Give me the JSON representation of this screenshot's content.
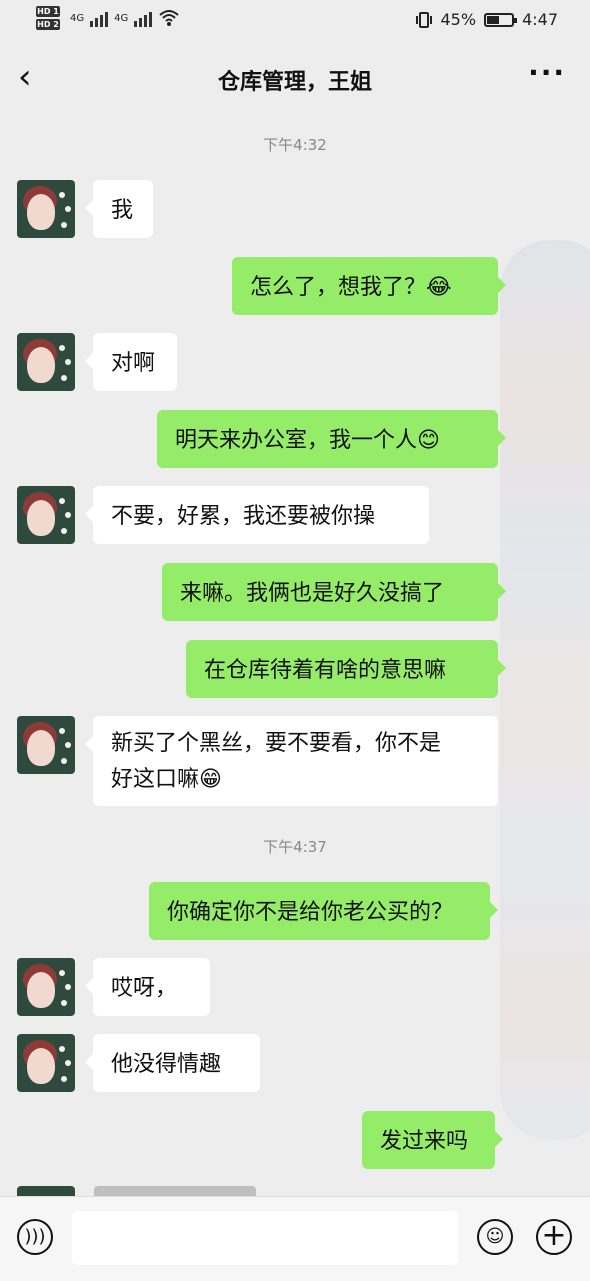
{
  "status": {
    "network_top": "HD 1",
    "network_bottom": "HD 2",
    "net_4g_1": "4G",
    "net_4g_2": "4G",
    "battery": "45%",
    "time": "4:47"
  },
  "header": {
    "back_icon": "chevron-left-icon",
    "title": "仓库管理，王姐",
    "more_icon": "more-icon"
  },
  "timestamps": {
    "first": "下午4:32",
    "second": "下午4:37"
  },
  "messages": [
    {
      "side": "in",
      "text": "我"
    },
    {
      "side": "out",
      "text": "怎么了，想我了？",
      "emoji": "😂"
    },
    {
      "side": "in",
      "text": "对啊"
    },
    {
      "side": "out",
      "text": "明天来办公室，我一个人",
      "emoji": "😊"
    },
    {
      "side": "in",
      "text": "不要，好累，我还要被你操"
    },
    {
      "side": "out",
      "text": "来嘛。我俩也是好久没搞了"
    },
    {
      "side": "out",
      "text": "在仓库待着有啥的意思嘛"
    },
    {
      "side": "in",
      "text_line1": "新买了个黑丝，要不要看，你不是",
      "text_line2": "好这口嘛",
      "emoji": "😁"
    },
    {
      "side": "out",
      "text": "你确定你不是给你老公买的？"
    },
    {
      "side": "in",
      "text": "哎呀，"
    },
    {
      "side": "in",
      "text": "他没得情趣"
    },
    {
      "side": "out",
      "text": "发过来吗"
    }
  ],
  "bottom_bar": {
    "voice_icon": "voice-icon",
    "emoji_icon": "emoji-icon",
    "plus_icon": "plus-icon"
  }
}
